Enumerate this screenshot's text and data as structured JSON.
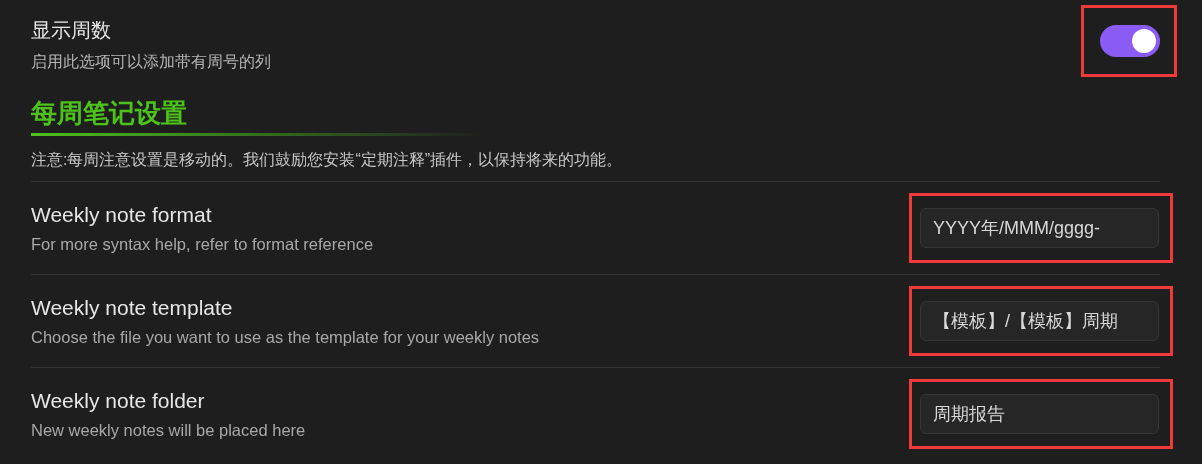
{
  "toggle_setting": {
    "title": "显示周数",
    "description": "启用此选项可以添加带有周号的列",
    "on": true,
    "highlighted": true
  },
  "section": {
    "heading": "每周笔记设置",
    "note": "注意:每周注意设置是移动的。我们鼓励您安装“定期注释”插件，以保持将来的功能。"
  },
  "settings": [
    {
      "title": "Weekly note format",
      "description": "For more syntax help, refer to format reference",
      "value": "YYYY年/MMM/gggg-",
      "highlighted": true
    },
    {
      "title": "Weekly note template",
      "description": "Choose the file you want to use as the template for your weekly notes",
      "value": "【模板】/【模板】周期",
      "highlighted": true
    },
    {
      "title": "Weekly note folder",
      "description": "New weekly notes will be placed here",
      "value": "周期报告",
      "highlighted": true
    }
  ]
}
